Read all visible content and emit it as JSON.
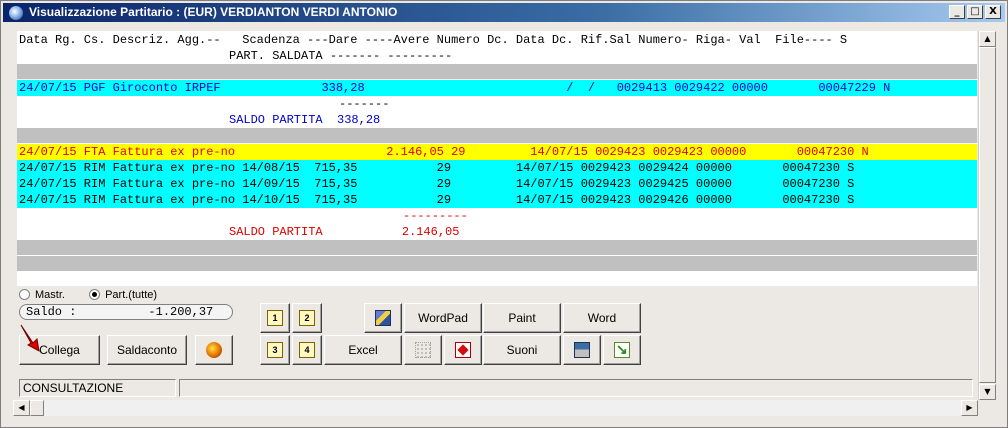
{
  "window": {
    "title": "Visualizzazione Partitario : (EUR) VERDIANTON VERDI ANTONIO",
    "minimize": "_",
    "maximize": "□",
    "close": "X"
  },
  "header": {
    "line1": "Data Rg. Cs. Descriz. Agg.--   Scadenza ---Dare ----Avere Numero Dc. Data Dc. Rif.Sal Numero- Riga- Val  File---- S",
    "line2": "PART. SALDATA ------- ---------"
  },
  "rows": [
    {
      "text": "24/07/15 PGF Giroconto IRPEF              338,28                            /  /   0029413 0029422 00000       00047229 N",
      "style": "cyan-blue"
    },
    {
      "text": "-------",
      "style": "white-black"
    },
    {
      "text": "SALDO PARTITA  338,28",
      "style": "white-blue"
    },
    {
      "text": "24/07/15 FTA Fattura ex pre-no                     2.146,05 29         14/07/15 0029423 0029423 00000       00047230 N",
      "style": "yellow-red"
    },
    {
      "text": "24/07/15 RIM Fattura ex pre-no 14/08/15  715,35           29         14/07/15 0029423 0029424 00000       00047230 S",
      "style": "cyan-black"
    },
    {
      "text": "24/07/15 RIM Fattura ex pre-no 14/09/15  715,35           29         14/07/15 0029423 0029425 00000       00047230 S",
      "style": "cyan-black"
    },
    {
      "text": "24/07/15 RIM Fattura ex pre-no 14/10/15  715,35           29         14/07/15 0029423 0029426 00000       00047230 S",
      "style": "cyan-black"
    },
    {
      "text": "---------",
      "style": "white-red"
    },
    {
      "text": "SALDO PARTITA           2.146,05",
      "style": "white-red"
    }
  ],
  "options": {
    "mastr_label": "Mastr.",
    "part_label": "Part.(tutte)",
    "selected": "Part.(tutte)"
  },
  "saldo": "Saldo :          -1.200,37",
  "buttons": {
    "collega": "Collega",
    "saldaconto": "Saldaconto",
    "page1": "1",
    "page2": "2",
    "page3": "3",
    "page4": "4",
    "excel": "Excel",
    "wordpad": "WordPad",
    "paint": "Paint",
    "word": "Word",
    "suoni": "Suoni"
  },
  "status": {
    "mode": "CONSULTAZIONE",
    "message": ""
  },
  "colors": {
    "cyan_row": "#00ffff",
    "yellow_row": "#ffff00",
    "gray_row": "#c0c0c0",
    "blue_text": "#0000cc",
    "red_text": "#e00000"
  }
}
